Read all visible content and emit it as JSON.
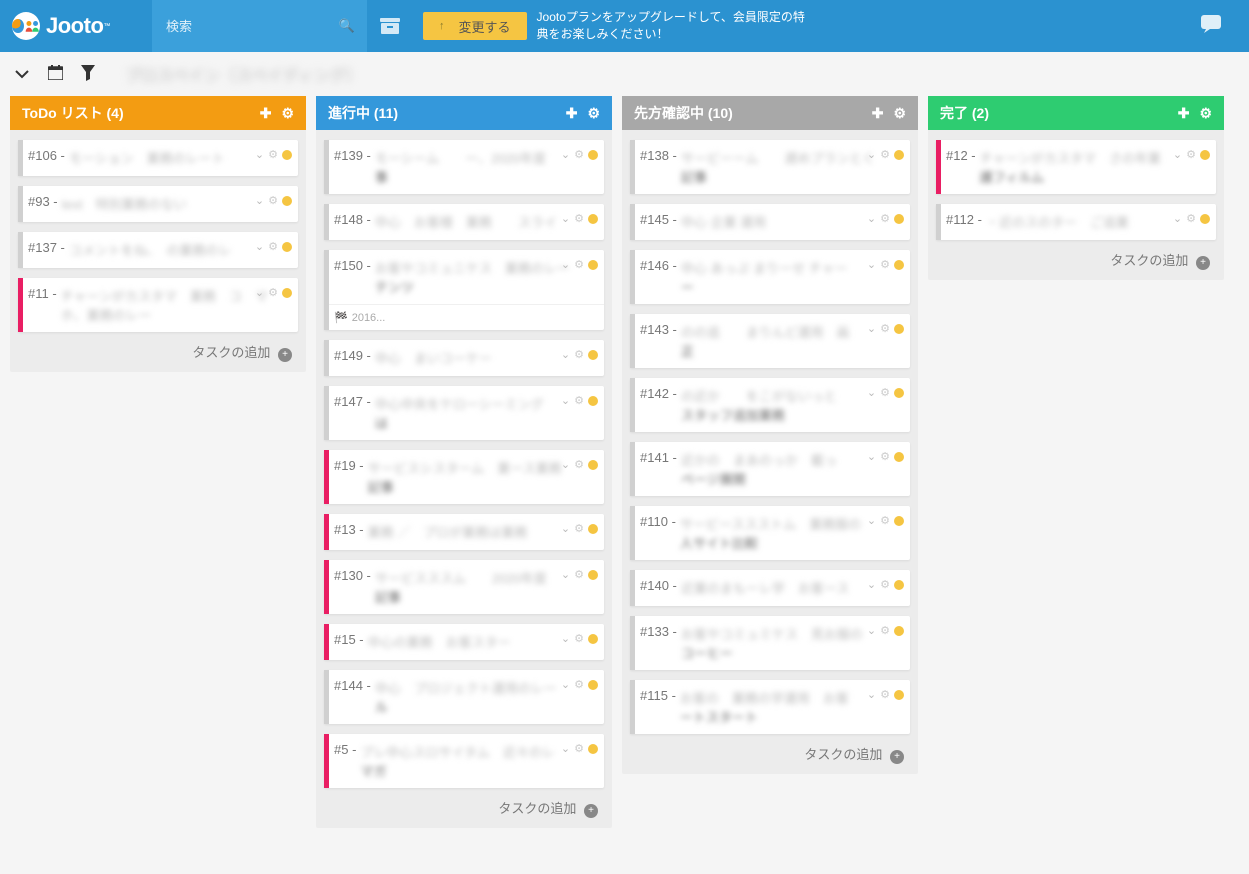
{
  "header": {
    "logo_text": "Jooto",
    "search_placeholder": "検索",
    "upgrade_button": "変更する",
    "upgrade_text": "Jootoプランをアップグレードして、会員限定の特典をお楽しみください！"
  },
  "toolbar": {
    "board_title": "プロスペイン（スペイディング）"
  },
  "add_task_label": "タスクの追加",
  "lists": [
    {
      "title": "ToDo リスト (4)",
      "color": "lh-orange",
      "cards": [
        {
          "id": "#106 - ",
          "stripe": "gray",
          "tall": false,
          "chev": true,
          "blur": "モーション　業務のレート"
        },
        {
          "id": "#93 - ",
          "stripe": "gray",
          "tall": false,
          "chev": true,
          "blur": "text　特別業務のない"
        },
        {
          "id": "#137 - ",
          "stripe": "gray",
          "tall": false,
          "chev": true,
          "blur": "コメントをね、　の業務のレ"
        },
        {
          "id": "#11 - ",
          "stripe": "magenta",
          "tall": true,
          "chev": true,
          "blur": "チャーンがカスタマ　業務　コ　マホ、業務のレー"
        }
      ]
    },
    {
      "title": "進行中 (11)",
      "color": "lh-blue",
      "cards": [
        {
          "id": "#139 - ",
          "stripe": "gray",
          "tall": true,
          "chev": true,
          "blur": "モーシーム　　ー、2020年度",
          "suffix": "事"
        },
        {
          "id": "#148 - ",
          "stripe": "gray",
          "tall": false,
          "chev": true,
          "blur": "中心　お客様　業務　　スライ"
        },
        {
          "id": "#150 - ",
          "stripe": "gray",
          "tall": true,
          "chev": true,
          "blur": "お客やコミュニケス　業務のレー",
          "suffix": "テンツ",
          "date": "2016..."
        },
        {
          "id": "#149 - ",
          "stripe": "gray",
          "tall": false,
          "chev": true,
          "blur": "中心　まいコーケー"
        },
        {
          "id": "#147 - ",
          "stripe": "gray",
          "tall": true,
          "chev": true,
          "blur": "中心中央をケローシーミング",
          "suffix": "は"
        },
        {
          "id": "#19 - ",
          "stripe": "magenta",
          "tall": true,
          "chev": true,
          "blur": "サービスシスターム　業ース業務",
          "suffix": "記事"
        },
        {
          "id": "#13 - ",
          "stripe": "magenta",
          "tall": false,
          "chev": true,
          "blur": "業務 ／　プロが業務は業務"
        },
        {
          "id": "#130 - ",
          "stripe": "magenta",
          "tall": true,
          "chev": true,
          "blur": "サービスススム　　2020年度",
          "suffix": "記事"
        },
        {
          "id": "#15 - ",
          "stripe": "magenta",
          "tall": false,
          "chev": true,
          "blur": "中心の業務　お客スター"
        },
        {
          "id": "#144 - ",
          "stripe": "gray",
          "tall": true,
          "chev": true,
          "blur": "中心　プロジェクト運用のレー",
          "suffix": "ル"
        },
        {
          "id": "#5 - ",
          "stripe": "magenta",
          "tall": true,
          "chev": true,
          "blur": "プレ中心スロサイタム　近々のレ",
          "suffix": "マガ"
        }
      ]
    },
    {
      "title": "先方確認中 (10)",
      "color": "lh-gray",
      "cards": [
        {
          "id": "#138 - ",
          "stripe": "gray",
          "tall": true,
          "chev": true,
          "blur": "サービーーム　　遅めプランとく",
          "suffix": "記事"
        },
        {
          "id": "#145 - ",
          "stripe": "gray",
          "tall": false,
          "chev": true,
          "blur": "中心 企業 運用"
        },
        {
          "id": "#146 - ",
          "stripe": "gray",
          "tall": true,
          "chev": true,
          "blur": "中心 あっぷ まりーせ チャー",
          "suffix": "ー"
        },
        {
          "id": "#143 - ",
          "stripe": "gray",
          "tall": true,
          "chev": true,
          "blur": "のの追　　まりんど運用　画　",
          "suffix": "正"
        },
        {
          "id": "#142 - ",
          "stripe": "gray",
          "tall": true,
          "chev": true,
          "blur": "の近か　　をこがないっと",
          "suffix": "スタッフ追加業務"
        },
        {
          "id": "#141 - ",
          "stripe": "gray",
          "tall": true,
          "chev": true,
          "blur": "近かの　まあのっか　載っ",
          "suffix": "ページ展開"
        },
        {
          "id": "#110 - ",
          "stripe": "gray",
          "tall": true,
          "chev": true,
          "blur": "サービーススストム　業務服の",
          "suffix": "人サイト比較"
        },
        {
          "id": "#140 - ",
          "stripe": "gray",
          "tall": false,
          "chev": true,
          "blur": "近業のまもーレ学　お客ース"
        },
        {
          "id": "#133 - ",
          "stripe": "gray",
          "tall": true,
          "chev": true,
          "blur": "お客やコミュミケス　見お服の",
          "suffix": "コーヒー"
        },
        {
          "id": "#115 - ",
          "stripe": "gray",
          "tall": true,
          "chev": true,
          "blur": "お客の　業務の学運用　お客",
          "suffix": "ートスタート"
        }
      ]
    },
    {
      "title": "完了 (2)",
      "color": "lh-green",
      "cards": [
        {
          "id": "#12 - ",
          "stripe": "magenta",
          "tall": true,
          "chev": true,
          "blur": "チャーンがカスタマ　さの年業",
          "suffix": "護フィルム"
        },
        {
          "id": "#112 - ",
          "stripe": "gray",
          "tall": false,
          "chev": true,
          "blur": "・近のスのター　ご追業"
        }
      ]
    }
  ]
}
